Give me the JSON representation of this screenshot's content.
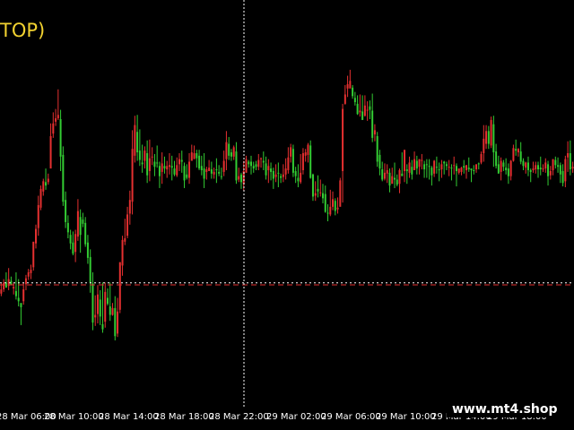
{
  "title": "TOP)",
  "watermark": "www.mt4.shop",
  "colors": {
    "background": "#000000",
    "bull": "#33cc33",
    "bear": "#e53030",
    "title": "#f2d230",
    "crosshair": "#ffffff",
    "axis_text": "#ffffff"
  },
  "chart_data": {
    "type": "candlestick",
    "x_ticks": [
      "28 Mar 06:00",
      "28 Mar 10:00",
      "28 Mar 14:00",
      "28 Mar 18:00",
      "28 Mar 22:00",
      "29 Mar 02:00",
      "29 Mar 06:00",
      "29 Mar 10:00",
      "29 Mar 14:00",
      "29 Mar 18:00"
    ],
    "crosshair_after_tick": "28 Mar 22:00",
    "reference_lines": [
      {
        "level": 145.2,
        "color": "#e53030",
        "style": "dashed"
      },
      {
        "level": 147.6,
        "color": "#ffffff",
        "style": "dotted"
      }
    ],
    "y_range": [
      0,
      480
    ],
    "candles": [
      [
        140,
        135,
        147,
        132
      ],
      [
        148,
        140,
        152,
        137
      ],
      [
        142,
        148,
        160,
        144
      ],
      [
        152,
        144,
        165,
        139
      ],
      [
        145,
        150,
        155,
        147
      ],
      [
        143,
        141,
        148,
        134
      ],
      [
        132,
        138,
        160,
        128
      ],
      [
        126,
        130,
        152,
        120
      ],
      [
        119,
        124,
        120,
        98
      ],
      [
        140,
        126,
        148,
        122
      ],
      [
        153,
        146,
        157,
        139
      ],
      [
        160,
        155,
        164,
        151
      ],
      [
        163,
        159,
        169,
        152
      ],
      [
        196,
        166,
        183,
        162
      ],
      [
        211,
        194,
        216,
        188
      ],
      [
        239,
        212,
        250,
        203
      ],
      [
        258,
        236,
        262,
        233
      ],
      [
        267,
        255,
        270,
        250
      ],
      [
        262,
        266,
        282,
        257
      ],
      [
        270,
        266,
        276,
        263
      ],
      [
        320,
        282,
        335,
        285
      ],
      [
        335,
        323,
        348,
        318
      ],
      [
        341,
        337,
        352,
        332
      ],
      [
        345,
        341,
        375,
        339
      ],
      [
        296,
        340,
        351,
        279
      ],
      [
        243,
        298,
        308,
        238
      ],
      [
        219,
        245,
        255,
        212
      ],
      [
        207,
        218,
        227,
        200
      ],
      [
        194,
        204,
        210,
        187
      ],
      [
        182,
        195,
        208,
        180
      ],
      [
        205,
        184,
        210,
        172
      ],
      [
        232,
        202,
        246,
        197
      ],
      [
        204,
        225,
        234,
        183
      ],
      [
        217,
        222,
        230,
        213
      ],
      [
        193,
        218,
        225,
        190
      ],
      [
        177,
        195,
        204,
        170
      ],
      [
        148,
        178,
        187,
        136
      ],
      [
        101,
        147,
        160,
        92
      ],
      [
        110,
        107,
        133,
        97
      ],
      [
        134,
        111,
        145,
        100
      ],
      [
        108,
        128,
        139,
        98
      ],
      [
        93,
        99,
        148,
        89
      ],
      [
        137,
        102,
        148,
        95
      ],
      [
        123,
        130,
        141,
        121
      ],
      [
        110,
        120,
        148,
        103
      ],
      [
        118,
        110,
        124,
        109
      ],
      [
        85,
        118,
        132,
        80
      ],
      [
        114,
        88,
        130,
        84
      ],
      [
        172,
        116,
        171,
        112
      ],
      [
        198,
        168,
        203,
        156
      ],
      [
        200,
        196,
        223,
        192
      ],
      [
        228,
        203,
        237,
        200
      ],
      [
        245,
        229,
        256,
        216
      ],
      [
        305,
        243,
        327,
        228
      ],
      [
        333,
        297,
        344,
        289
      ],
      [
        301,
        325,
        345,
        291
      ],
      [
        292,
        303,
        328,
        285
      ],
      [
        287,
        289,
        310,
        277
      ],
      [
        303,
        291,
        308,
        282
      ],
      [
        274,
        300,
        315,
        265
      ],
      [
        294,
        279,
        316,
        267
      ],
      [
        296,
        295,
        307,
        286
      ],
      [
        284,
        290,
        299,
        273
      ],
      [
        289,
        289,
        309,
        283
      ],
      [
        273,
        285,
        290,
        259
      ],
      [
        288,
        278,
        301,
        264
      ],
      [
        282,
        285,
        296,
        276
      ],
      [
        285,
        281,
        291,
        271
      ],
      [
        286,
        284,
        300,
        275
      ],
      [
        283,
        285,
        297,
        268
      ],
      [
        275,
        282,
        291,
        273
      ],
      [
        286,
        274,
        295,
        272
      ],
      [
        293,
        287,
        300,
        279
      ],
      [
        290,
        292,
        303,
        277
      ],
      [
        268,
        285,
        289,
        259
      ],
      [
        271,
        275,
        287,
        269
      ],
      [
        290,
        271,
        300,
        264
      ],
      [
        301,
        291,
        310,
        293
      ],
      [
        300,
        293,
        309,
        294
      ],
      [
        294,
        300,
        304,
        283
      ],
      [
        282,
        297,
        304,
        280
      ],
      [
        280,
        285,
        297,
        274
      ],
      [
        270,
        282,
        300,
        259
      ],
      [
        281,
        278,
        284,
        269
      ],
      [
        283,
        279,
        292,
        282
      ],
      [
        276,
        281,
        290,
        270
      ],
      [
        278,
        275,
        283,
        270
      ],
      [
        281,
        281,
        294,
        265
      ],
      [
        276,
        278,
        286,
        273
      ],
      [
        272,
        273,
        283,
        269
      ],
      [
        291,
        278,
        303,
        273
      ],
      [
        313,
        293,
        326,
        280
      ],
      [
        297,
        311,
        319,
        292
      ],
      [
        296,
        301,
        305,
        291
      ],
      [
        307,
        296,
        309,
        292
      ],
      [
        268,
        302,
        313,
        264
      ],
      [
        273,
        269,
        283,
        266
      ],
      [
        266,
        275,
        277,
        258
      ],
      [
        279,
        264,
        291,
        256
      ],
      [
        293,
        277,
        297,
        281
      ],
      [
        287,
        290,
        292,
        283
      ],
      [
        285,
        290,
        297,
        275
      ],
      [
        282,
        285,
        290,
        277
      ],
      [
        284,
        287,
        291,
        280
      ],
      [
        292,
        284,
        299,
        280
      ],
      [
        294,
        293,
        295,
        283
      ],
      [
        289,
        291,
        302,
        280
      ],
      [
        274,
        288,
        296,
        269
      ],
      [
        285,
        280,
        293,
        265
      ],
      [
        278,
        282,
        289,
        268
      ],
      [
        270,
        279,
        283,
        258
      ],
      [
        275,
        272,
        287,
        266
      ],
      [
        277,
        277,
        289,
        260
      ],
      [
        271,
        273,
        276,
        265
      ],
      [
        275,
        272,
        287,
        266
      ],
      [
        282,
        275,
        294,
        269
      ],
      [
        295,
        280,
        307,
        276
      ],
      [
        307,
        296,
        311,
        289
      ],
      [
        277,
        305,
        310,
        272
      ],
      [
        273,
        279,
        284,
        265
      ],
      [
        267,
        271,
        287,
        260
      ],
      [
        277,
        266,
        299,
        264
      ],
      [
        300,
        280,
        306,
        275
      ],
      [
        301,
        297,
        305,
        290
      ],
      [
        310,
        298,
        312,
        289
      ],
      [
        271,
        309,
        315,
        270
      ],
      [
        249,
        275,
        276,
        244
      ],
      [
        253,
        250,
        267,
        244
      ],
      [
        255,
        258,
        274,
        248
      ],
      [
        254,
        253,
        269,
        249
      ],
      [
        247,
        253,
        264,
        241
      ],
      [
        231,
        252,
        262,
        230
      ],
      [
        230,
        230,
        240,
        220
      ],
      [
        237,
        228,
        257,
        226
      ],
      [
        246,
        237,
        255,
        233
      ],
      [
        232,
        244,
        247,
        227
      ],
      [
        236,
        234,
        248,
        229
      ],
      [
        268,
        237,
        271,
        239
      ],
      [
        352,
        279,
        358,
        242
      ],
      [
        369,
        358,
        380,
        357
      ],
      [
        381,
        376,
        391,
        366
      ],
      [
        385,
        376,
        398,
        380
      ],
      [
        367,
        377,
        380,
        364
      ],
      [
        360,
        365,
        372,
        356
      ],
      [
        346,
        358,
        368,
        345
      ],
      [
        350,
        348,
        369,
        343
      ],
      [
        339,
        349,
        368,
        342
      ],
      [
        356,
        344,
        368,
        343
      ],
      [
        351,
        350,
        361,
        338
      ],
      [
        351,
        355,
        362,
        340
      ],
      [
        318,
        350,
        370,
        313
      ],
      [
        327,
        322,
        334,
        314
      ],
      [
        290,
        320,
        325,
        284
      ],
      [
        282,
        298,
        304,
        274
      ],
      [
        269,
        281,
        290,
        267
      ],
      [
        277,
        270,
        288,
        268
      ],
      [
        280,
        276,
        287,
        265
      ],
      [
        262,
        277,
        282,
        254
      ],
      [
        273,
        264,
        283,
        266
      ],
      [
        269,
        271,
        289,
        259
      ],
      [
        263,
        269,
        275,
        261
      ],
      [
        280,
        264,
        282,
        253
      ],
      [
        273,
        276,
        301,
        274
      ],
      [
        304,
        279,
        303,
        266
      ],
      [
        279,
        281,
        287,
        264
      ],
      [
        289,
        277,
        296,
        271
      ],
      [
        275,
        284,
        292,
        269
      ],
      [
        293,
        280,
        302,
        283
      ],
      [
        282,
        291,
        297,
        275
      ],
      [
        293,
        284,
        293,
        275
      ],
      [
        292,
        291,
        299,
        281
      ],
      [
        281,
        287,
        291,
        271
      ],
      [
        287,
        287,
        293,
        271
      ],
      [
        284,
        285,
        293,
        269
      ],
      [
        274,
        283,
        285,
        262
      ],
      [
        291,
        276,
        292,
        272
      ],
      [
        283,
        284,
        296,
        276
      ],
      [
        281,
        281,
        289,
        267
      ],
      [
        287,
        281,
        292,
        271
      ],
      [
        288,
        290,
        291,
        275
      ],
      [
        285,
        287,
        290,
        280
      ],
      [
        284,
        283,
        292,
        273
      ],
      [
        282,
        283,
        287,
        268
      ],
      [
        286,
        285,
        296,
        275
      ],
      [
        279,
        285,
        288,
        261
      ],
      [
        282,
        277,
        282,
        275
      ],
      [
        283,
        278,
        284,
        274
      ],
      [
        283,
        285,
        292,
        276
      ],
      [
        286,
        280,
        286,
        270
      ],
      [
        281,
        283,
        295,
        278
      ],
      [
        280,
        282,
        282,
        266
      ],
      [
        279,
        280,
        286,
        275
      ],
      [
        287,
        281,
        287,
        277
      ],
      [
        288,
        288,
        289,
        281
      ],
      [
        299,
        289,
        302,
        287
      ],
      [
        317,
        300,
        333,
        290
      ],
      [
        326,
        311,
        333,
        305
      ],
      [
        311,
        326,
        332,
        305
      ],
      [
        339,
        309,
        343,
        306
      ],
      [
        301,
        334,
        344,
        284
      ],
      [
        285,
        302,
        311,
        282
      ],
      [
        276,
        287,
        297,
        280
      ],
      [
        291,
        278,
        295,
        268
      ],
      [
        284,
        289,
        292,
        279
      ],
      [
        280,
        283,
        294,
        275
      ],
      [
        273,
        282,
        288,
        264
      ],
      [
        291,
        273,
        292,
        268
      ],
      [
        306,
        291,
        310,
        290
      ],
      [
        303,
        305,
        316,
        297
      ],
      [
        305,
        301,
        306,
        296
      ],
      [
        290,
        302,
        313,
        287
      ],
      [
        285,
        291,
        294,
        280
      ],
      [
        289,
        283,
        290,
        276
      ],
      [
        280,
        289,
        296,
        273
      ],
      [
        278,
        280,
        282,
        266
      ],
      [
        282,
        280,
        290,
        277
      ],
      [
        286,
        281,
        290,
        276
      ],
      [
        281,
        286,
        290,
        271
      ],
      [
        281,
        283,
        296,
        274
      ],
      [
        282,
        281,
        287,
        278
      ],
      [
        289,
        282,
        294,
        277
      ],
      [
        273,
        287,
        291,
        262
      ],
      [
        279,
        274,
        285,
        269
      ],
      [
        293,
        280,
        293,
        274
      ],
      [
        286,
        292,
        296,
        282
      ],
      [
        284,
        286,
        295,
        277
      ],
      [
        275,
        286,
        289,
        265
      ],
      [
        265,
        279,
        287,
        261
      ],
      [
        293,
        267,
        297,
        260
      ],
      [
        300,
        295,
        314,
        278
      ],
      [
        281,
        300,
        315,
        274
      ],
      [
        284,
        282,
        290,
        277
      ]
    ]
  }
}
